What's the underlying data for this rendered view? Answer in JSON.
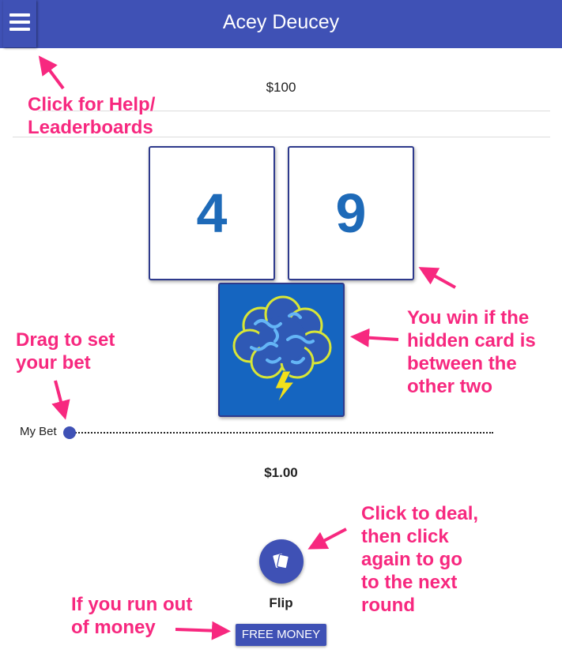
{
  "header": {
    "title": "Acey Deucey",
    "menu_icon": "hamburger-menu-icon"
  },
  "balance": "$100",
  "cards": {
    "left": "4",
    "right": "9",
    "hidden_card_icon": "brain-lightning-icon"
  },
  "bet": {
    "slider_label": "My Bet",
    "amount": "$1.00"
  },
  "actions": {
    "flip_label": "Flip",
    "flip_icon": "cards-icon",
    "free_money_label": "FREE MONEY"
  },
  "annotations": {
    "help": [
      "Click for Help/",
      "Leaderboards"
    ],
    "win": [
      "You win if the",
      "hidden card is",
      "between the",
      "other two"
    ],
    "bet": [
      "Drag to set",
      "your bet"
    ],
    "deal": [
      "Click to deal,",
      "then click",
      "again to go",
      "to the next",
      "round"
    ],
    "money": [
      "If you run out",
      "of money"
    ]
  },
  "colors": {
    "primary": "#3f51b5",
    "card_number": "#1e6ab8",
    "hidden_card_bg": "#1565c0",
    "annotation": "#f7287f"
  }
}
